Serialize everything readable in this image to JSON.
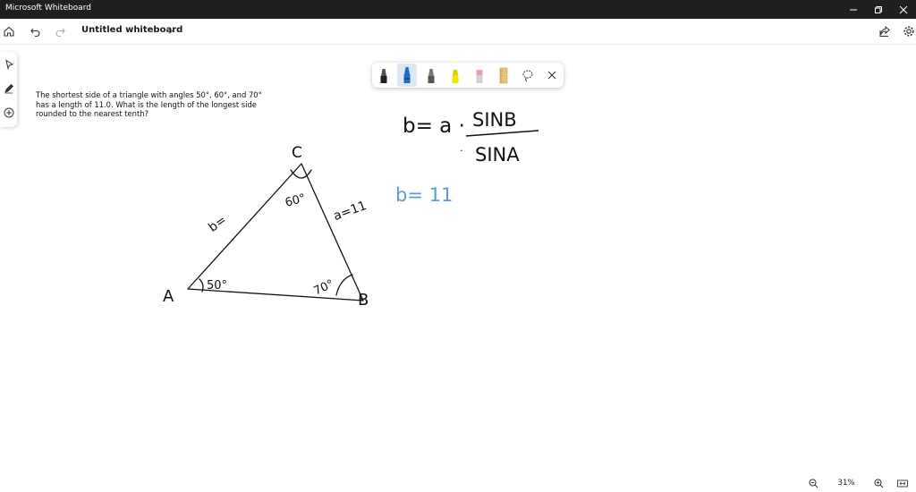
{
  "titlebar": {
    "app_title": "Microsoft Whiteboard"
  },
  "toolbar": {
    "doc_title": "Untitled whiteboard"
  },
  "question": {
    "lines": [
      "The shortest side of a triangle with angles 50°, 60°, and 70°",
      "has a length of 11.0. What is the length of the longest side",
      "rounded to the nearest tenth?"
    ]
  },
  "ink": {
    "vertex_a": "A",
    "vertex_b": "B",
    "vertex_c": "C",
    "angle_a": "50°",
    "angle_b": "70°",
    "angle_c": "60°",
    "side_a": "a=11",
    "side_b": "b=",
    "formula_lhs": "b= a ·",
    "formula_numerator": "SINB",
    "formula_denominator": "SINA",
    "formula_dot": "·",
    "result_blue": "b= 11"
  },
  "pen_tray": {
    "tools": [
      "black-pen",
      "blue-pen",
      "gray-pen",
      "yellow-highlighter",
      "eraser",
      "ruler",
      "lasso-select"
    ],
    "active_tool": "blue-pen",
    "colors": {
      "black": "#222222",
      "blue": "#1e6fc8",
      "gray": "#555555",
      "highlighter": "#f2e600",
      "eraser": "#e9a0a8",
      "ruler": "#e8c27a"
    }
  },
  "zoom": {
    "level": "31%"
  },
  "colors": {
    "titlebar": "#1f1f1f",
    "ink": "#111111",
    "blue_ink": "#5b9bd5"
  }
}
